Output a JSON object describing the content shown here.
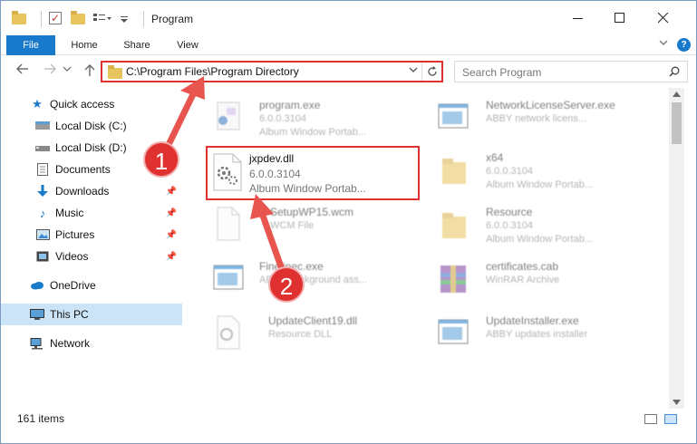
{
  "window": {
    "title": "Program"
  },
  "ribbon": {
    "file_tab": "File",
    "home_tab": "Home",
    "share_tab": "Share",
    "view_tab": "View"
  },
  "nav": {
    "address": "C:\\Program Files\\Program Directory",
    "search_placeholder": "Search Program"
  },
  "sidebar": {
    "items": [
      {
        "label": "Quick access",
        "icon": "star-icon"
      },
      {
        "label": "Local Disk (C:)",
        "icon": "drive-icon"
      },
      {
        "label": "Local Disk (D:)",
        "icon": "drive-icon"
      },
      {
        "label": "Documents",
        "icon": "documents-icon"
      },
      {
        "label": "Downloads",
        "icon": "download-icon"
      },
      {
        "label": "Music",
        "icon": "music-icon"
      },
      {
        "label": "Pictures",
        "icon": "pictures-icon"
      },
      {
        "label": "Videos",
        "icon": "videos-icon"
      },
      {
        "label": "OneDrive",
        "icon": "cloud-icon"
      },
      {
        "label": "This PC",
        "icon": "computer-icon"
      },
      {
        "label": "Network",
        "icon": "network-icon"
      }
    ]
  },
  "files": [
    {
      "name": "program.exe",
      "line2": "6.0.0.3104",
      "line3": "Album Window Portab..."
    },
    {
      "name": "NetworkLicenseServer.exe",
      "line2": "ABBY network licens...",
      "line3": ""
    },
    {
      "name": "jxpdev.dll",
      "line2": "6.0.0.3104",
      "line3": "Album Window Portab..."
    },
    {
      "name": "x64",
      "line2": "6.0.0.3104",
      "line3": "Album Window Portab..."
    },
    {
      "name": "SetupWP15.wcm",
      "line2": "WCM File",
      "line3": ""
    },
    {
      "name": "Resource",
      "line2": "6.0.0.3104",
      "line3": "Album Window Portab..."
    },
    {
      "name": "Finelinec.exe",
      "line2": "ABBY background ass...",
      "line3": ""
    },
    {
      "name": "certificates.cab",
      "line2": "WinRAR Archive",
      "line3": ""
    },
    {
      "name": "UpdateClient19.dll",
      "line2": "Resource DLL",
      "line3": ""
    },
    {
      "name": "UpdateInstaller.exe",
      "line2": "ABBY updates installer",
      "line3": ""
    }
  ],
  "status": {
    "count": "161 items"
  },
  "annotations": {
    "step1": "1",
    "step2": "2"
  },
  "colors": {
    "accent": "#1979ca",
    "highlight": "#e03131",
    "selected": "#cce4f7"
  }
}
